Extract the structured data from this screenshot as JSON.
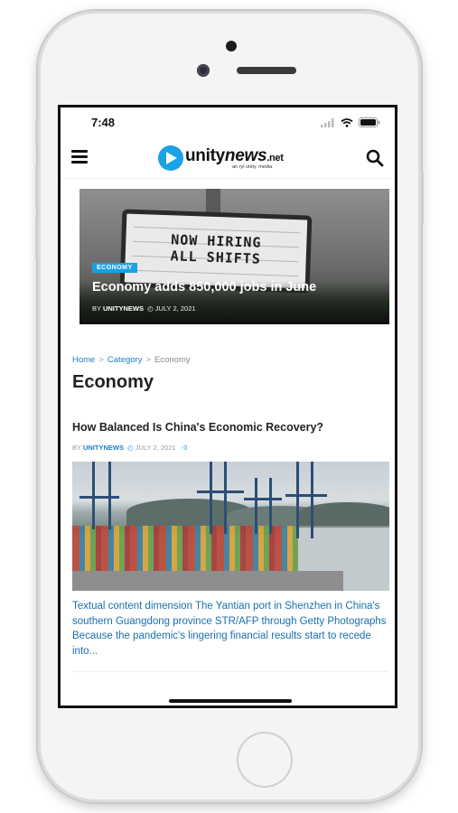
{
  "status_bar": {
    "time": "7:48"
  },
  "header": {
    "logo": {
      "name": "unity",
      "name_accent": "news",
      "tld": ".net",
      "tagline": "an ryl unity. media"
    }
  },
  "hero": {
    "category": "ECONOMY",
    "title": "Economy adds 850,000 jobs in June",
    "byline_prefix": "BY",
    "author": "UNITYNEWS",
    "date": "JULY 2, 2021",
    "sign_line1": "NOW HIRING",
    "sign_line2": "ALL SHIFTS"
  },
  "breadcrumb": {
    "home": "Home",
    "category": "Category",
    "current": "Economy",
    "separator": ">"
  },
  "page_title": "Economy",
  "article": {
    "title": "How Balanced Is China's Economic Recovery?",
    "byline_prefix": "BY",
    "author": "UNITYNEWS",
    "date": "JULY 2, 2021",
    "comments": "0",
    "excerpt": "Textual content dimension The Yantian port in Shenzhen in China's southern Guangdong province STR/AFP through Getty Photographs Because the pandemic's lingering financial results start to recede into..."
  },
  "colors": {
    "accent": "#1aa1e6",
    "link": "#1a7fc7"
  }
}
